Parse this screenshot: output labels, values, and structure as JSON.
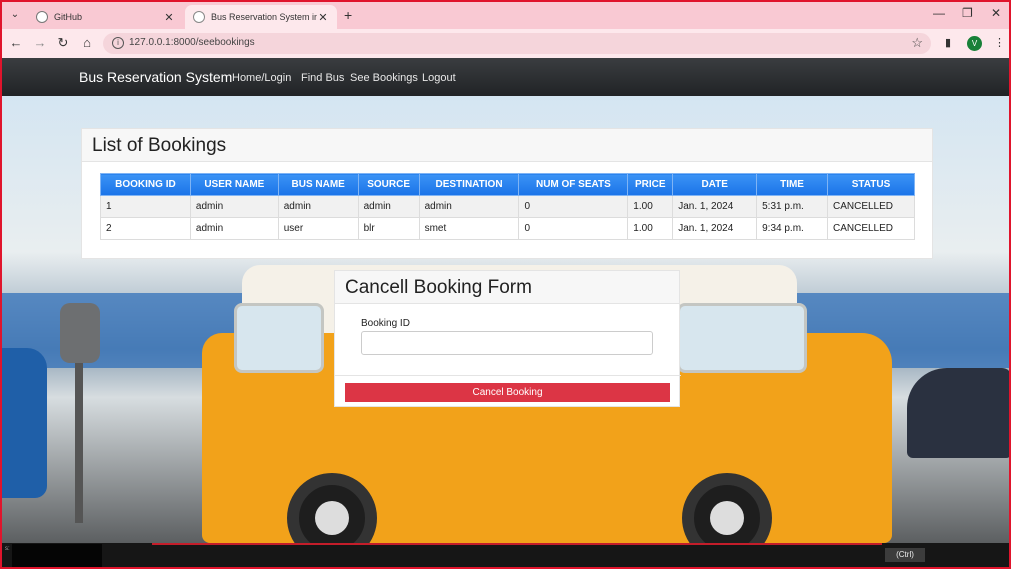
{
  "browser": {
    "tabs": [
      {
        "title": "GitHub",
        "active": false
      },
      {
        "title": "Bus Reservation System in Djan",
        "active": true
      }
    ],
    "url": "127.0.0.1:8000/seebookings",
    "avatar_letter": "V"
  },
  "navbar": {
    "brand": "Bus Reservation System",
    "links": [
      "Home/Login",
      "Find Bus",
      "See Bookings",
      "Logout"
    ]
  },
  "bookings": {
    "heading": "List of Bookings",
    "columns": [
      "BOOKING ID",
      "USER NAME",
      "BUS NAME",
      "SOURCE",
      "DESTINATION",
      "NUM OF SEATS",
      "PRICE",
      "DATE",
      "TIME",
      "STATUS"
    ],
    "rows": [
      [
        "1",
        "admin",
        "admin",
        "admin",
        "admin",
        "0",
        "1.00",
        "Jan. 1, 2024",
        "5:31 p.m.",
        "CANCELLED"
      ],
      [
        "2",
        "admin",
        "user",
        "blr",
        "smet",
        "0",
        "1.00",
        "Jan. 1, 2024",
        "9:34 p.m.",
        "CANCELLED"
      ]
    ]
  },
  "cancel_form": {
    "heading": "Cancell Booking Form",
    "field_label": "Booking ID",
    "field_value": "",
    "button_label": "Cancel Booking"
  },
  "taskbar": {
    "ime_label": "(Ctrl)",
    "corner_text": "s:"
  },
  "colors": {
    "frame_border": "#e0142c",
    "table_header": "#1a73e8",
    "cancel_button": "#dc3545",
    "navbar": "#212326"
  }
}
